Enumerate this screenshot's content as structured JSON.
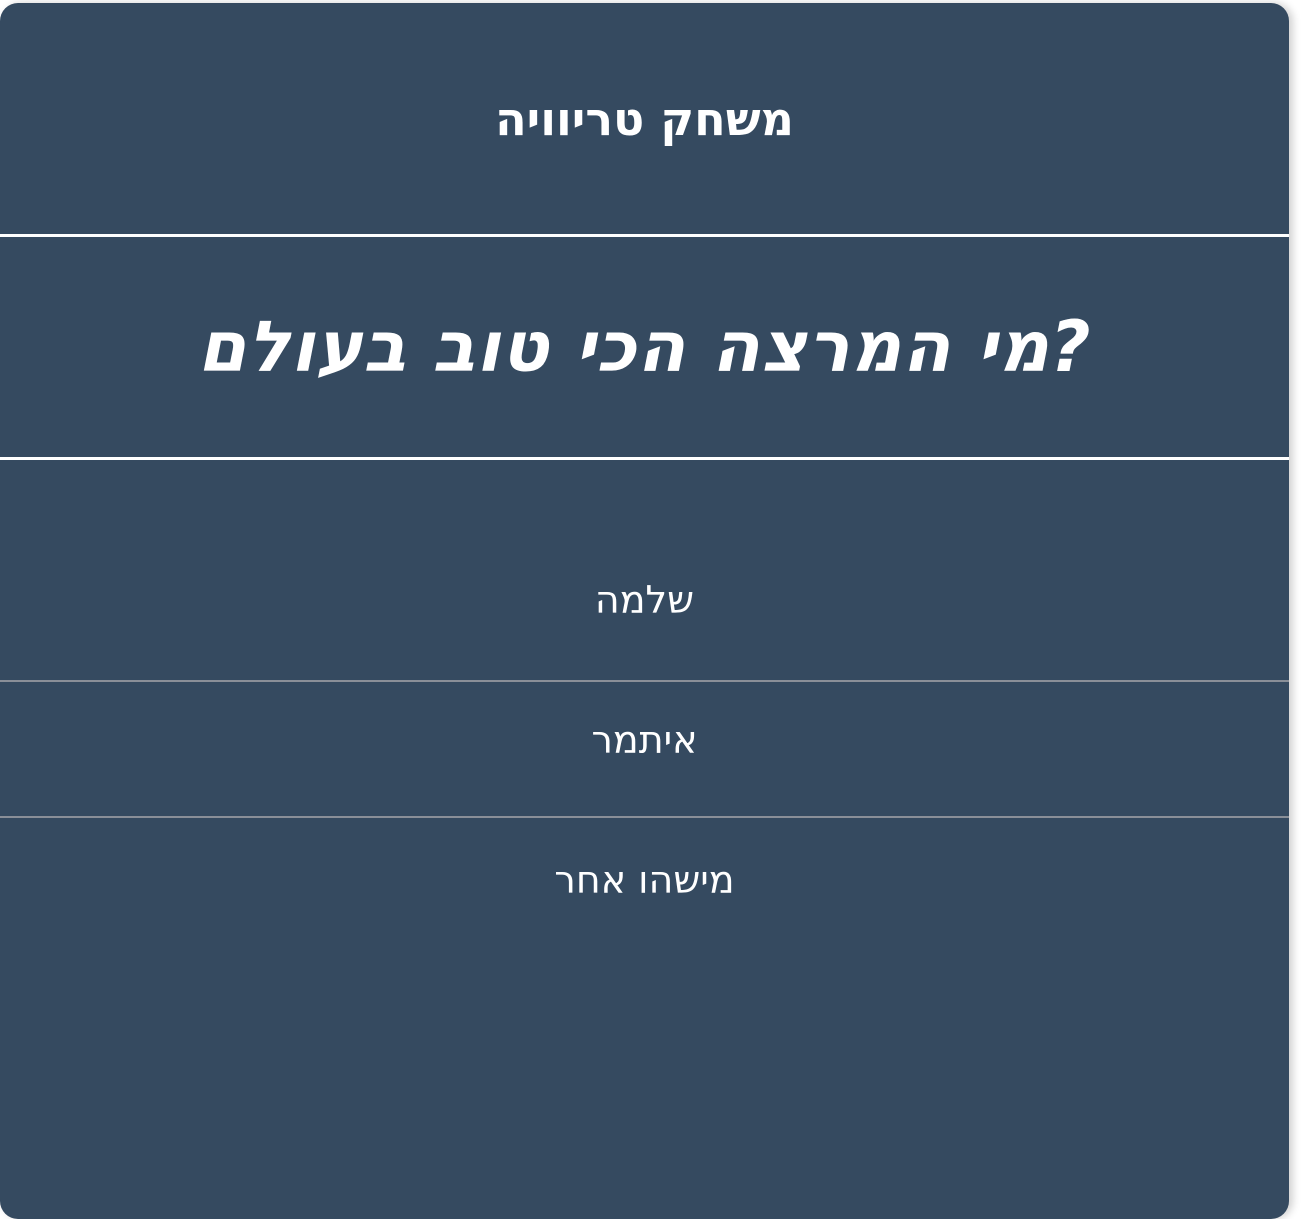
{
  "game": {
    "title": "משחק טריוויה",
    "question": "?מי המרצה הכי טוב בעולם",
    "answers": [
      {
        "label": "שלמה"
      },
      {
        "label": "איתמר"
      },
      {
        "label": "מישהו אחר"
      }
    ]
  },
  "colors": {
    "card_background": "#354a60",
    "text": "#ffffff",
    "header_divider": "#ffffff",
    "answer_divider": "#8a8f98"
  }
}
